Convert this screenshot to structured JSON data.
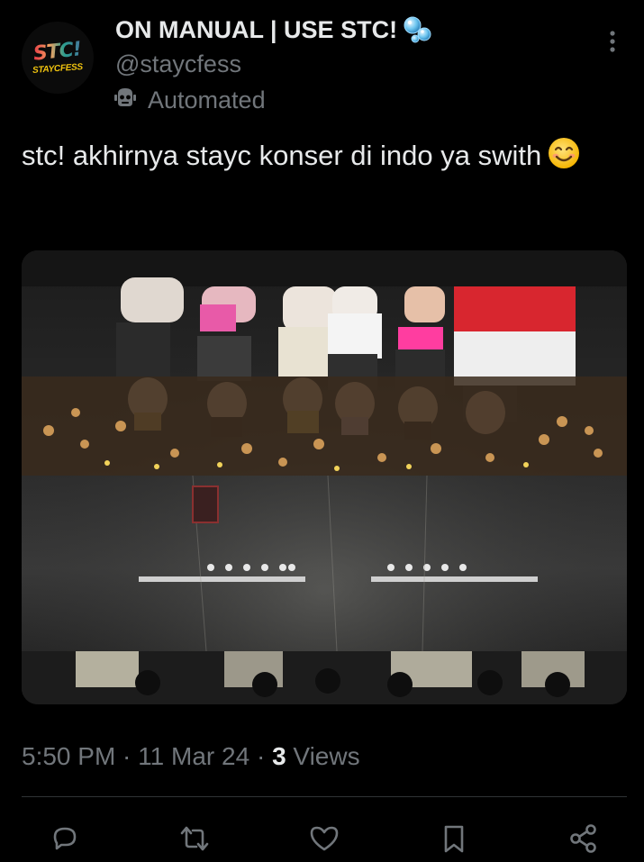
{
  "post": {
    "display_name": "ON MANUAL | USE STC!",
    "handle": "@staycfess",
    "automated_label": "Automated",
    "avatar_text": "STC!",
    "avatar_subtext": "STAYCFESS",
    "text": "stc! akhirnya stayc konser di indo ya swith",
    "emoji": "smiling-face-emoji",
    "image_alt": "Concert photo"
  },
  "meta": {
    "time": "5:50 PM",
    "separator1": " · ",
    "date": "11 Mar 24",
    "separator2": " · ",
    "views_count": "3",
    "views_label": " Views"
  },
  "icons": {
    "bubbles": "bubbles-icon",
    "automated": "robot-icon",
    "more": "more-vertical-icon",
    "reply": "reply-icon",
    "repost": "repost-icon",
    "like": "like-icon",
    "bookmark": "bookmark-icon",
    "share": "share-icon"
  },
  "colors": {
    "background": "#000000",
    "text_primary": "#e7e9ea",
    "text_secondary": "#71767b",
    "divider": "#2f3336"
  }
}
